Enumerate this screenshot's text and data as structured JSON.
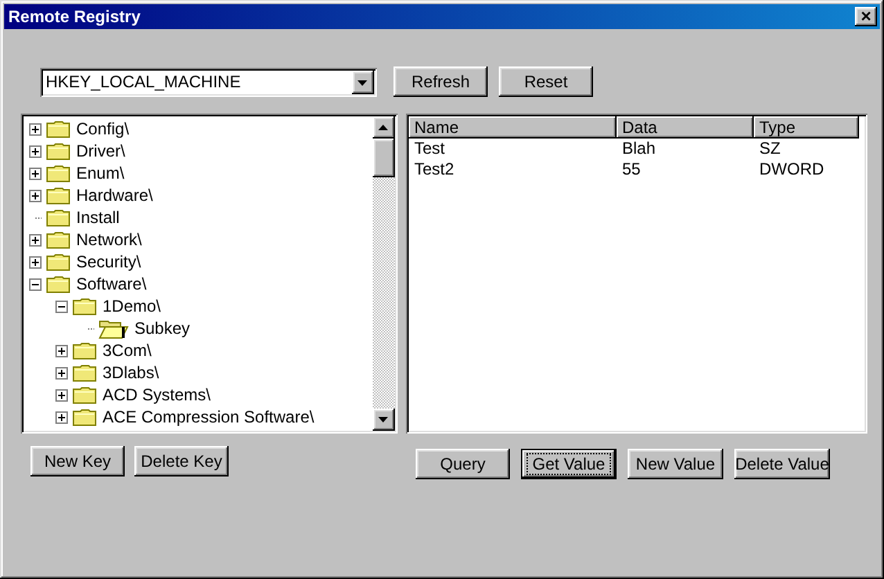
{
  "window": {
    "title": "Remote Registry",
    "close": "×"
  },
  "hive_select": {
    "value": "HKEY_LOCAL_MACHINE"
  },
  "top_buttons": [
    {
      "label": "Refresh",
      "focused": false
    },
    {
      "label": "Reset",
      "focused": false
    }
  ],
  "tree": {
    "items": [
      {
        "label": "Config\\",
        "expanded": false,
        "selected": false
      },
      {
        "label": "Driver\\",
        "expanded": false,
        "selected": false
      },
      {
        "label": "Enum\\",
        "expanded": false,
        "selected": false
      },
      {
        "label": "Hardware\\",
        "expanded": false,
        "selected": false
      },
      {
        "label": "Install",
        "selected": false
      },
      {
        "label": "Network\\",
        "expanded": false,
        "selected": false
      },
      {
        "label": "Security\\",
        "expanded": false,
        "selected": false
      },
      {
        "label": "Software\\",
        "expanded": true,
        "selected": false,
        "children": [
          {
            "label": "1Demo\\",
            "expanded": true,
            "selected": false,
            "children": [
              {
                "label": "Subkey",
                "selected": true
              }
            ]
          },
          {
            "label": "3Com\\",
            "expanded": false,
            "selected": false
          },
          {
            "label": "3Dlabs\\",
            "expanded": false,
            "selected": false
          },
          {
            "label": "ACD Systems\\",
            "expanded": false,
            "selected": false
          },
          {
            "label": "ACE Compression Software\\",
            "expanded": false,
            "selected": false
          }
        ]
      }
    ]
  },
  "values_table": {
    "columns": [
      "Name",
      "Data",
      "Type"
    ],
    "rows": [
      [
        "Test",
        "Blah",
        "SZ"
      ],
      [
        "Test2",
        "55",
        "DWORD"
      ]
    ]
  },
  "key_buttons": [
    {
      "label": "New Key",
      "focused": false
    },
    {
      "label": "Delete Key",
      "focused": false
    }
  ],
  "value_buttons": [
    {
      "label": "Query",
      "focused": false
    },
    {
      "label": "Get Value",
      "focused": true
    },
    {
      "label": "New Value",
      "focused": false
    },
    {
      "label": "Delete Value",
      "focused": false
    }
  ]
}
